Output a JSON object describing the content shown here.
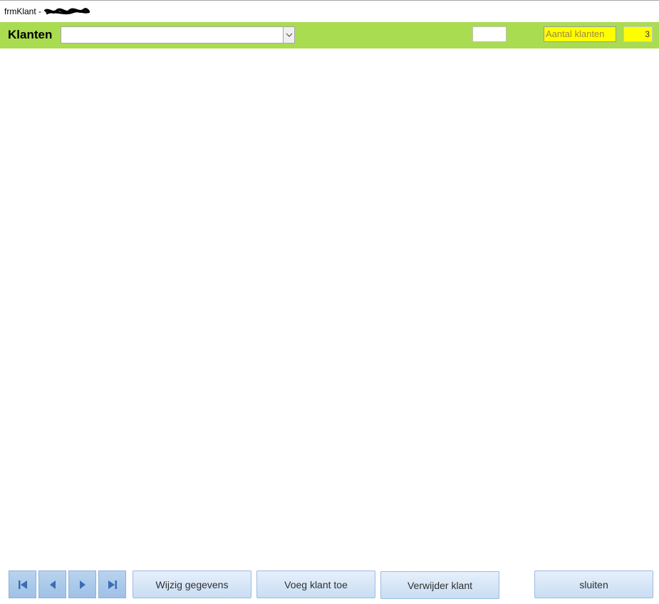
{
  "window": {
    "title_prefix": "frmKlant -"
  },
  "header": {
    "title": "Klanten",
    "combo": {
      "value": ""
    },
    "small_box_value": "",
    "count_label": "Aantal klanten",
    "count_value": "3",
    "colors": {
      "band": "#a9dc50",
      "highlight": "#ffff00"
    }
  },
  "navigation": [
    {
      "name": "first-record",
      "icon": "first-record-icon"
    },
    {
      "name": "previous-record",
      "icon": "previous-record-icon"
    },
    {
      "name": "next-record",
      "icon": "next-record-icon"
    },
    {
      "name": "last-record",
      "icon": "last-record-icon"
    }
  ],
  "buttons": {
    "edit": "Wijzig gegevens",
    "add": "Voeg klant toe",
    "delete": "Verwijder klant",
    "close": "sluiten"
  }
}
